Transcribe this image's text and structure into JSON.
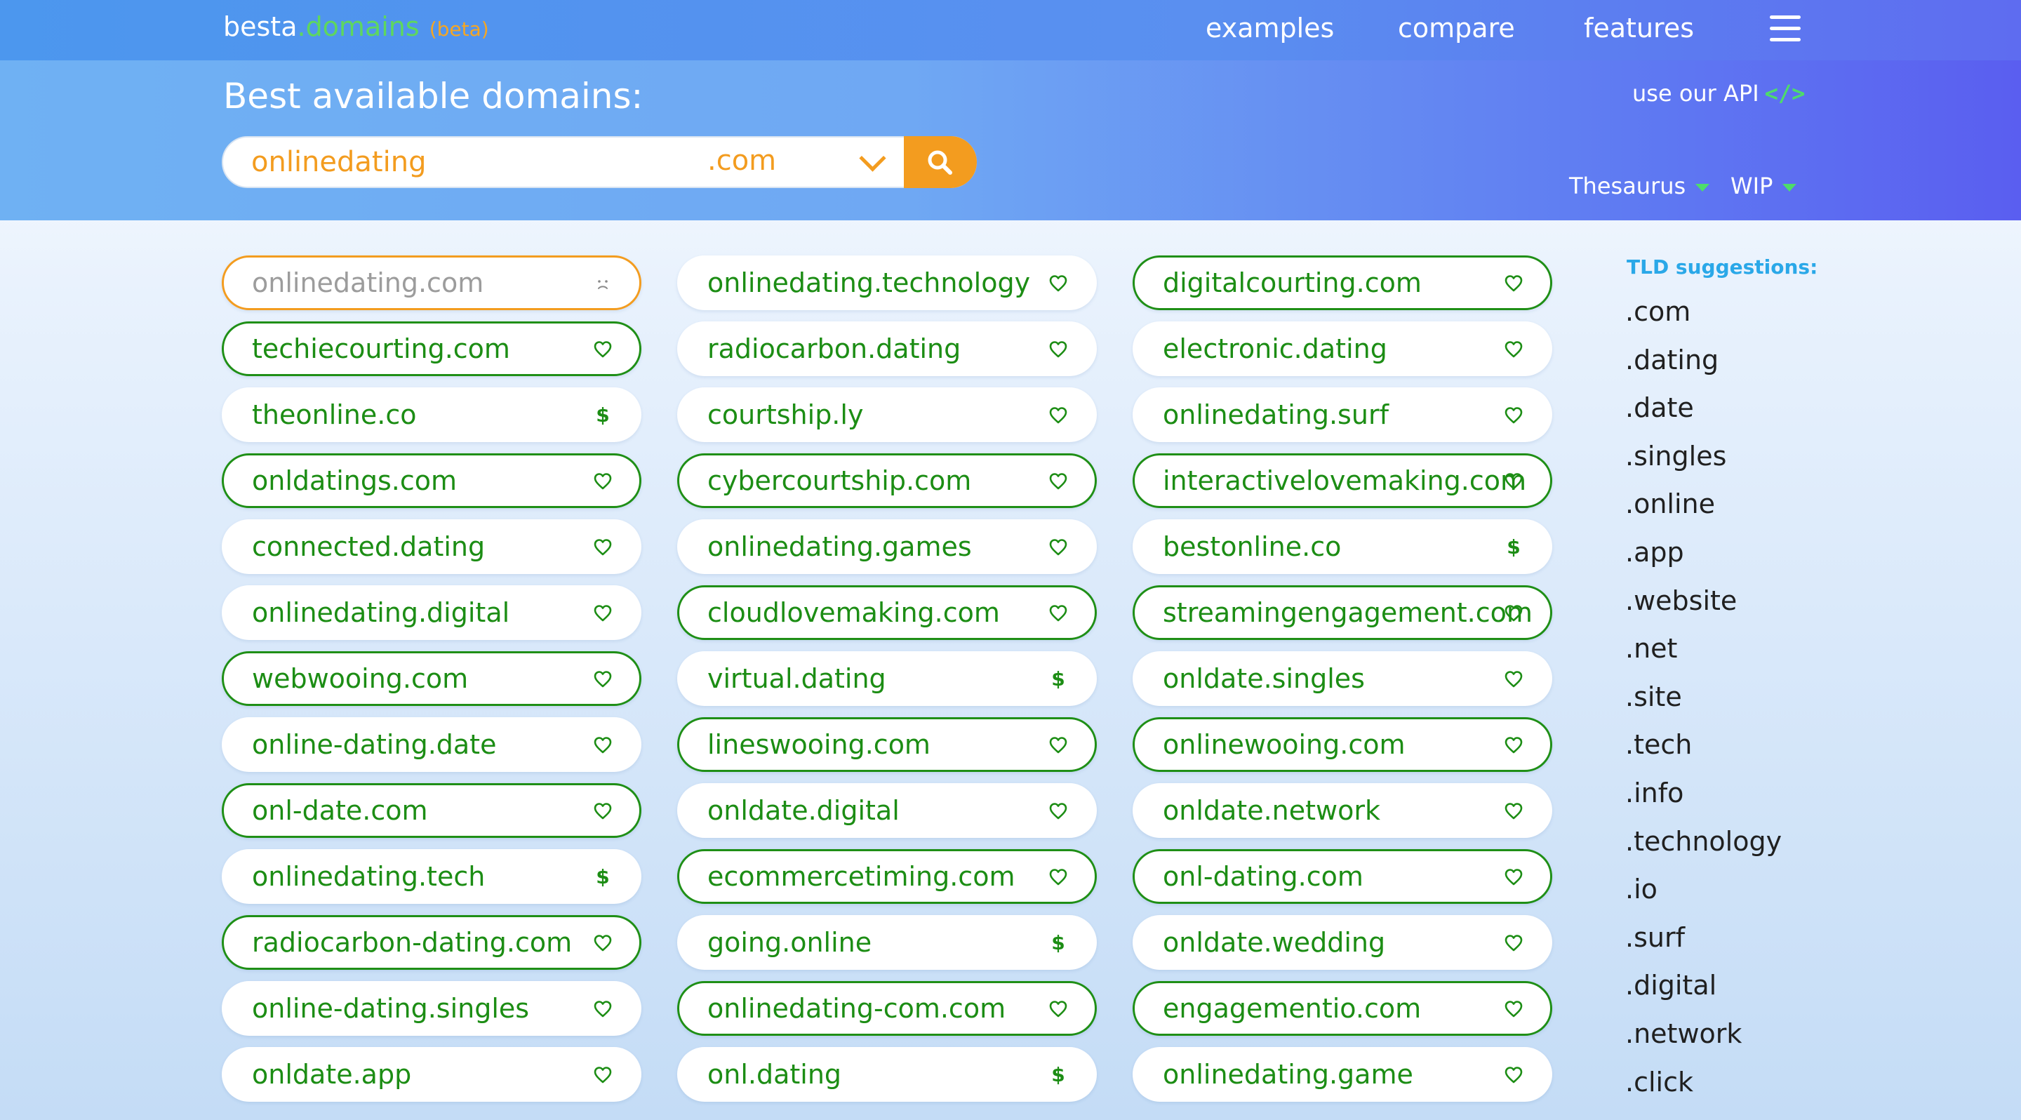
{
  "header": {
    "brand_name": "besta",
    "brand_domain": ".domains",
    "brand_tag": "(beta)",
    "nav": [
      "examples",
      "compare",
      "features"
    ]
  },
  "hero": {
    "title": "Best available domains:",
    "api_link": "use our API",
    "api_icon": "</>",
    "search_value": "onlinedating",
    "tld_selected": ".com",
    "filters": [
      "Thesaurus",
      "WIP"
    ]
  },
  "colors": {
    "available": "#1c8d14",
    "accent": "#f39c1f",
    "taken_text": "#9c9c9c",
    "tld_title": "#2aa8e8"
  },
  "results": [
    [
      {
        "name": "onlinedating.com",
        "status": "taken",
        "icon": "sad-face-icon",
        "outlined": false
      },
      {
        "name": "techiecourting.com",
        "status": "available",
        "icon": "heart-icon",
        "outlined": true
      },
      {
        "name": "theonline.co",
        "status": "available",
        "icon": "dollar-icon",
        "outlined": false
      },
      {
        "name": "onldatings.com",
        "status": "available",
        "icon": "heart-icon",
        "outlined": true
      },
      {
        "name": "connected.dating",
        "status": "available",
        "icon": "heart-icon",
        "outlined": false
      },
      {
        "name": "onlinedating.digital",
        "status": "available",
        "icon": "heart-icon",
        "outlined": false
      },
      {
        "name": "webwooing.com",
        "status": "available",
        "icon": "heart-icon",
        "outlined": true
      },
      {
        "name": "online-dating.date",
        "status": "available",
        "icon": "heart-icon",
        "outlined": false
      },
      {
        "name": "onl-date.com",
        "status": "available",
        "icon": "heart-icon",
        "outlined": true
      },
      {
        "name": "onlinedating.tech",
        "status": "available",
        "icon": "dollar-icon",
        "outlined": false
      },
      {
        "name": "radiocarbon-dating.com",
        "status": "available",
        "icon": "heart-icon",
        "outlined": true
      },
      {
        "name": "online-dating.singles",
        "status": "available",
        "icon": "heart-icon",
        "outlined": false
      },
      {
        "name": "onldate.app",
        "status": "available",
        "icon": "heart-icon",
        "outlined": false
      }
    ],
    [
      {
        "name": "onlinedating.technology",
        "status": "available",
        "icon": "heart-icon",
        "outlined": false
      },
      {
        "name": "radiocarbon.dating",
        "status": "available",
        "icon": "heart-icon",
        "outlined": false
      },
      {
        "name": "courtship.ly",
        "status": "available",
        "icon": "heart-icon",
        "outlined": false
      },
      {
        "name": "cybercourtship.com",
        "status": "available",
        "icon": "heart-icon",
        "outlined": true
      },
      {
        "name": "onlinedating.games",
        "status": "available",
        "icon": "heart-icon",
        "outlined": false
      },
      {
        "name": "cloudlovemaking.com",
        "status": "available",
        "icon": "heart-icon",
        "outlined": true
      },
      {
        "name": "virtual.dating",
        "status": "available",
        "icon": "dollar-icon",
        "outlined": false
      },
      {
        "name": "lineswooing.com",
        "status": "available",
        "icon": "heart-icon",
        "outlined": true
      },
      {
        "name": "onldate.digital",
        "status": "available",
        "icon": "heart-icon",
        "outlined": false
      },
      {
        "name": "ecommercetiming.com",
        "status": "available",
        "icon": "heart-icon",
        "outlined": true
      },
      {
        "name": "going.online",
        "status": "available",
        "icon": "dollar-icon",
        "outlined": false
      },
      {
        "name": "onlinedating-com.com",
        "status": "available",
        "icon": "heart-icon",
        "outlined": true
      },
      {
        "name": "onl.dating",
        "status": "available",
        "icon": "dollar-icon",
        "outlined": false
      }
    ],
    [
      {
        "name": "digitalcourting.com",
        "status": "available",
        "icon": "heart-icon",
        "outlined": true
      },
      {
        "name": "electronic.dating",
        "status": "available",
        "icon": "heart-icon",
        "outlined": false
      },
      {
        "name": "onlinedating.surf",
        "status": "available",
        "icon": "heart-icon",
        "outlined": false
      },
      {
        "name": "interactivelovemaking.com",
        "status": "available",
        "icon": "heart-icon",
        "outlined": true
      },
      {
        "name": "bestonline.co",
        "status": "available",
        "icon": "dollar-icon",
        "outlined": false
      },
      {
        "name": "streamingengagement.com",
        "status": "available",
        "icon": "heart-icon",
        "outlined": true
      },
      {
        "name": "onldate.singles",
        "status": "available",
        "icon": "heart-icon",
        "outlined": false
      },
      {
        "name": "onlinewooing.com",
        "status": "available",
        "icon": "heart-icon",
        "outlined": true
      },
      {
        "name": "onldate.network",
        "status": "available",
        "icon": "heart-icon",
        "outlined": false
      },
      {
        "name": "onl-dating.com",
        "status": "available",
        "icon": "heart-icon",
        "outlined": true
      },
      {
        "name": "onldate.wedding",
        "status": "available",
        "icon": "heart-icon",
        "outlined": false
      },
      {
        "name": "engagementio.com",
        "status": "available",
        "icon": "heart-icon",
        "outlined": true
      },
      {
        "name": "onlinedating.game",
        "status": "available",
        "icon": "heart-icon",
        "outlined": false
      }
    ]
  ],
  "sidebar": {
    "title": "TLD suggestions:",
    "tlds": [
      ".com",
      ".dating",
      ".date",
      ".singles",
      ".online",
      ".app",
      ".website",
      ".net",
      ".site",
      ".tech",
      ".info",
      ".technology",
      ".io",
      ".surf",
      ".digital",
      ".network",
      ".click"
    ]
  }
}
